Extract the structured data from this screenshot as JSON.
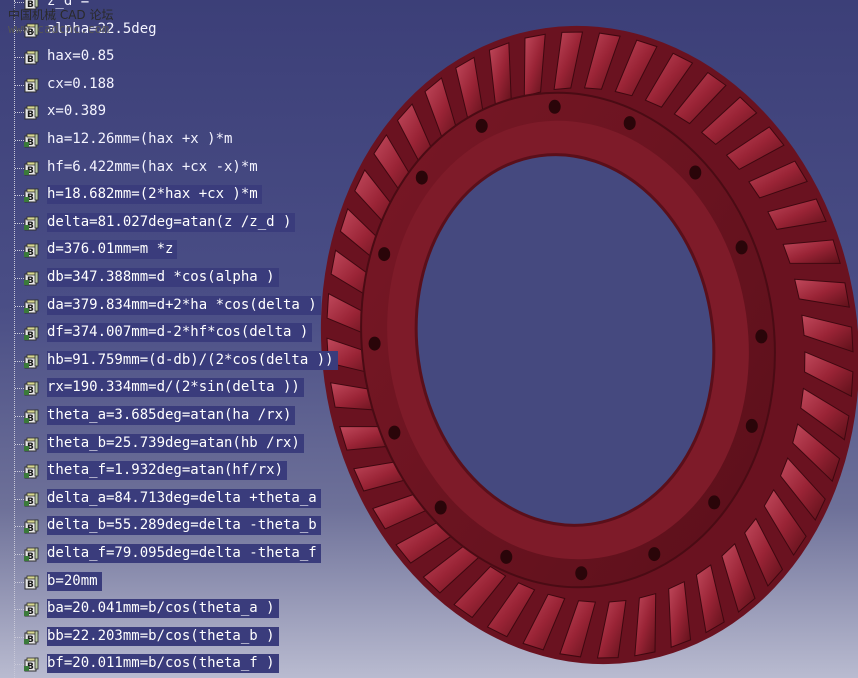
{
  "watermark": {
    "line1": "中国机械 CAD 论坛",
    "line2": "www.cadcnc.com"
  },
  "colors": {
    "background_top": "#3c3f78",
    "background_bottom": "#b9bbd0",
    "gear": "#8e1f2e",
    "selection": "#3a3c7c"
  },
  "parameters": [
    {
      "text": "z_d =",
      "icon": "parameter-icon",
      "selected": false
    },
    {
      "text": "alpha=22.5deg",
      "icon": "parameter-icon",
      "selected": false
    },
    {
      "text": "hax=0.85",
      "icon": "parameter-icon",
      "selected": false
    },
    {
      "text": "cx=0.188",
      "icon": "parameter-icon",
      "selected": false
    },
    {
      "text": "x=0.389",
      "icon": "parameter-icon",
      "selected": false
    },
    {
      "text": "ha=12.26mm=(hax +x )*m",
      "icon": "formula-icon",
      "selected": false
    },
    {
      "text": "hf=6.422mm=(hax +cx -x)*m",
      "icon": "formula-icon",
      "selected": false
    },
    {
      "text": "h=18.682mm=(2*hax +cx )*m",
      "icon": "formula-icon",
      "selected": true
    },
    {
      "text": "delta=81.027deg=atan(z /z_d )",
      "icon": "formula-icon",
      "selected": true
    },
    {
      "text": "d=376.01mm=m *z",
      "icon": "formula-icon",
      "selected": true
    },
    {
      "text": "db=347.388mm=d *cos(alpha )",
      "icon": "formula-icon",
      "selected": true
    },
    {
      "text": "da=379.834mm=d+2*ha *cos(delta )",
      "icon": "formula-icon",
      "selected": true
    },
    {
      "text": "df=374.007mm=d-2*hf*cos(delta )",
      "icon": "formula-icon",
      "selected": true
    },
    {
      "text": "hb=91.759mm=(d-db)/(2*cos(delta ))",
      "icon": "formula-icon",
      "selected": true
    },
    {
      "text": "rx=190.334mm=d/(2*sin(delta ))",
      "icon": "formula-icon",
      "selected": true
    },
    {
      "text": "theta_a=3.685deg=atan(ha /rx)",
      "icon": "formula-icon",
      "selected": true
    },
    {
      "text": "theta_b=25.739deg=atan(hb /rx)",
      "icon": "formula-icon",
      "selected": true
    },
    {
      "text": "theta_f=1.932deg=atan(hf/rx)",
      "icon": "formula-icon",
      "selected": true
    },
    {
      "text": "delta_a=84.713deg=delta +theta_a",
      "icon": "formula-icon",
      "selected": true
    },
    {
      "text": "delta_b=55.289deg=delta -theta_b",
      "icon": "formula-icon",
      "selected": true
    },
    {
      "text": "delta_f=79.095deg=delta -theta_f",
      "icon": "formula-icon",
      "selected": true
    },
    {
      "text": "b=20mm",
      "icon": "parameter-icon",
      "selected": true
    },
    {
      "text": "ba=20.041mm=b/cos(theta_a )",
      "icon": "formula-icon",
      "selected": true
    },
    {
      "text": "bb=22.203mm=b/cos(theta_b )",
      "icon": "formula-icon",
      "selected": true
    },
    {
      "text": "bf=20.011mm=b/cos(theta_f )",
      "icon": "formula-icon",
      "selected": true
    }
  ]
}
